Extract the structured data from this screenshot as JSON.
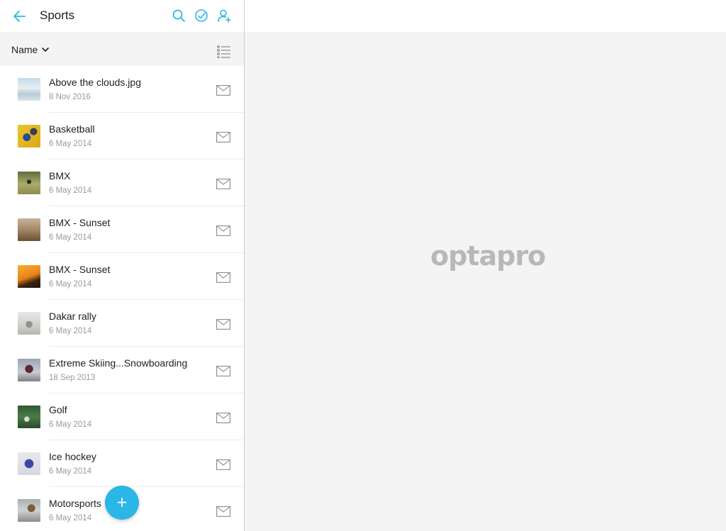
{
  "header": {
    "title": "Sports",
    "back_icon": "arrow-left-icon",
    "icons": [
      "search-icon",
      "select-check-icon",
      "add-user-icon"
    ],
    "accent_color": "#2ab6e6"
  },
  "sort": {
    "label": "Name",
    "icon": "chevron-down-icon",
    "view_icon": "list-view-icon"
  },
  "items": [
    {
      "name": "Above the clouds.jpg",
      "date": "8 Nov 2016",
      "icon": "mail-icon"
    },
    {
      "name": "Basketball",
      "date": "6 May 2014",
      "icon": "mail-icon"
    },
    {
      "name": "BMX",
      "date": "6 May 2014",
      "icon": "mail-icon"
    },
    {
      "name": "BMX - Sunset",
      "date": "6 May 2014",
      "icon": "mail-icon"
    },
    {
      "name": "BMX - Sunset",
      "date": "6 May 2014",
      "icon": "mail-icon"
    },
    {
      "name": "Dakar rally",
      "date": "6 May 2014",
      "icon": "mail-icon"
    },
    {
      "name": "Extreme Skiing...Snowboarding",
      "date": "18 Sep 2013",
      "icon": "mail-icon"
    },
    {
      "name": "Golf",
      "date": "6 May 2014",
      "icon": "mail-icon"
    },
    {
      "name": "Ice hockey",
      "date": "6 May 2014",
      "icon": "mail-icon"
    },
    {
      "name": "Motorsports",
      "date": "6 May 2014",
      "icon": "mail-icon"
    }
  ],
  "fab": {
    "label": "+",
    "icon": "plus-icon"
  },
  "detail": {
    "logo": "optapro"
  }
}
